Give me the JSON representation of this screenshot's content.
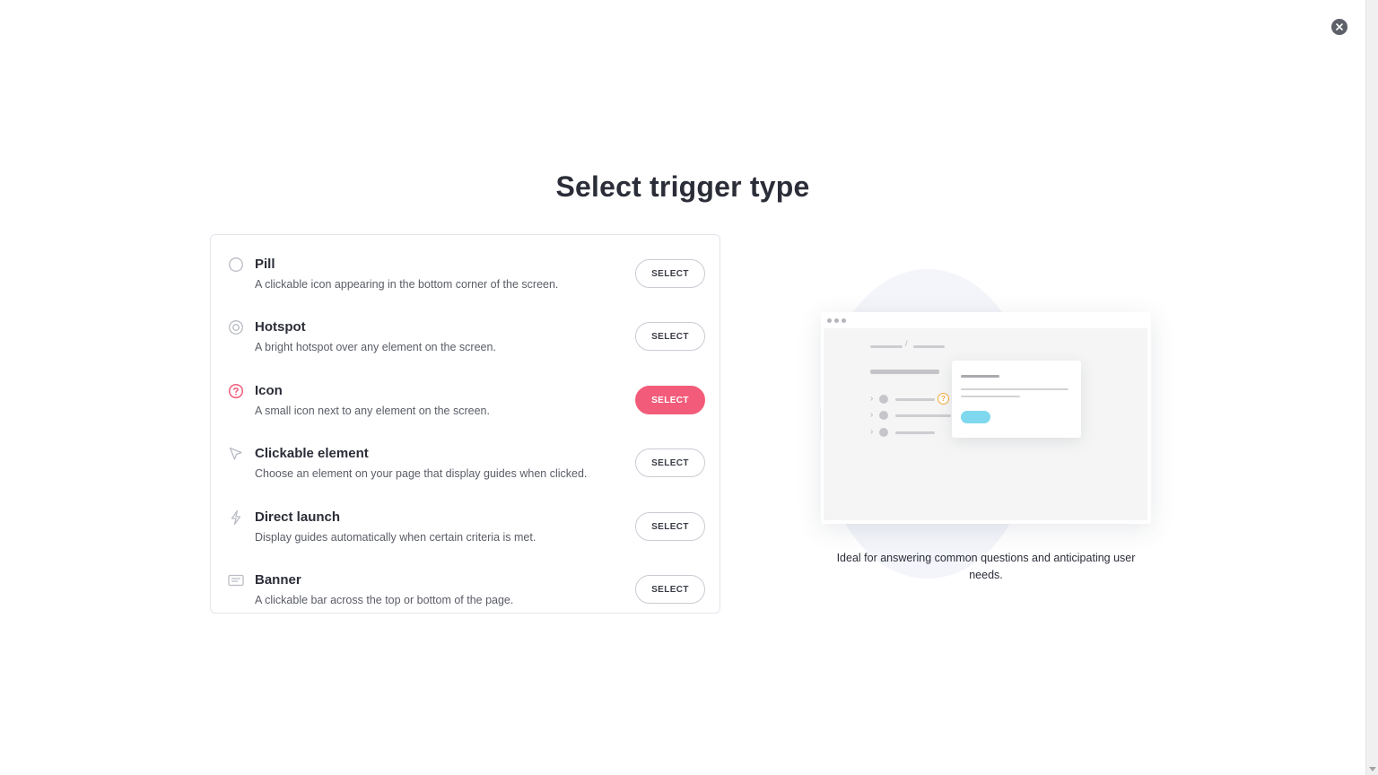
{
  "page": {
    "title": "Select trigger type"
  },
  "colors": {
    "accent": "#f25c7a",
    "popup_button": "#7fd8ee",
    "hotspot_question": "#f2a93b"
  },
  "options": [
    {
      "name": "pill",
      "icon": "pill-icon",
      "title": "Pill",
      "description": "A clickable icon appearing in the bottom corner of the screen.",
      "button": "SELECT",
      "selected": false
    },
    {
      "name": "hotspot",
      "icon": "hotspot-icon",
      "title": "Hotspot",
      "description": "A bright hotspot over any element on the screen.",
      "button": "SELECT",
      "selected": false
    },
    {
      "name": "icon",
      "icon": "question-circle-icon",
      "title": "Icon",
      "description": "A small icon next to any element on the screen.",
      "button": "SELECT",
      "selected": true
    },
    {
      "name": "clickable-element",
      "icon": "cursor-icon",
      "title": "Clickable element",
      "description": "Choose an element on your page that display guides when clicked.",
      "button": "SELECT",
      "selected": false
    },
    {
      "name": "direct-launch",
      "icon": "lightning-icon",
      "title": "Direct launch",
      "description": "Display guides automatically when certain criteria is met.",
      "button": "SELECT",
      "selected": false
    },
    {
      "name": "banner",
      "icon": "banner-icon",
      "title": "Banner",
      "description": "A clickable bar across the top or bottom of the page.",
      "button": "SELECT",
      "selected": false
    }
  ],
  "illustration": {
    "caption": "Ideal for answering common questions and anticipating user needs.",
    "breadcrumb_separator": "/",
    "question_mark": "?"
  }
}
